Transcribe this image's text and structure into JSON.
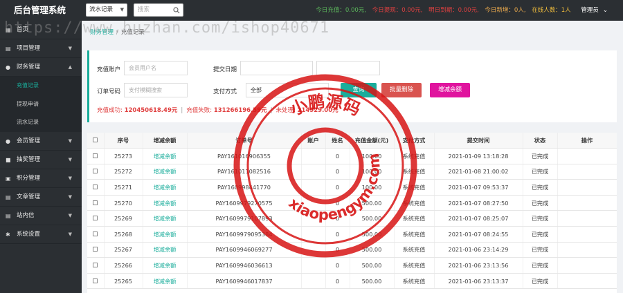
{
  "header": {
    "brand": "后台管理系统",
    "record_select": "流水记录",
    "search_placeholder": "搜索",
    "stats": [
      {
        "text": "今日充值：0.00元,",
        "color": "green"
      },
      {
        "text": "今日提现：0.00元,",
        "color": "red"
      },
      {
        "text": "明日到期：0.00元,",
        "color": "red"
      },
      {
        "text": "今日新增：0人,",
        "color": "orange"
      },
      {
        "text": "在线人数：1人",
        "color": "yellow"
      }
    ],
    "admin": "管理员"
  },
  "sidebar": {
    "items": [
      {
        "label": "首页",
        "icon": "grid-icon"
      },
      {
        "label": "项目管理",
        "icon": "list-icon"
      },
      {
        "label": "财务管理",
        "icon": "money-icon"
      },
      {
        "label": "会员管理",
        "icon": "user-icon"
      },
      {
        "label": "抽奖管理",
        "icon": "gift-icon"
      },
      {
        "label": "积分管理",
        "icon": "points-icon"
      },
      {
        "label": "文章管理",
        "icon": "doc-icon"
      },
      {
        "label": "站内信",
        "icon": "mail-icon"
      },
      {
        "label": "系统设置",
        "icon": "gear-icon"
      }
    ],
    "finance_sub": [
      "充值记录",
      "提现申请",
      "流水记录"
    ]
  },
  "breadcrumb": {
    "parent": "财务管理",
    "current": "充值记录"
  },
  "filter": {
    "account_label": "充值账户",
    "account_placeholder": "会员用户名",
    "date_label": "提交日期",
    "order_label": "订单号码",
    "order_placeholder": "支付模糊搜索",
    "pay_label": "支付方式",
    "pay_value": "全部",
    "search_button": "查询",
    "batch_delete_button": "批量删除",
    "adjust_button": "增减余额",
    "summary_success_label": "充值成功:",
    "summary_success_value": "120450618.49元",
    "summary_fail_label": "充值失败:",
    "summary_fail_value": "131266196.59元",
    "summary_pending_label": "未处理:",
    "summary_pending_value": "214929.00元"
  },
  "table": {
    "headers": [
      "序号",
      "增减余额",
      "订单号",
      "账户",
      "姓名",
      "充值金额(元)",
      "支付方式",
      "提交时间",
      "状态",
      "操作"
    ],
    "rows": [
      [
        "25273",
        "增减余额",
        "PAY161016906355",
        "",
        "0",
        "100.00",
        "系统充值",
        "2021-01-09 13:18:28",
        "已完成"
      ],
      [
        "25272",
        "增减余额",
        "PAY161011082516",
        "",
        "0",
        "100.00",
        "系统充值",
        "2021-01-08 21:00:02",
        "已完成"
      ],
      [
        "25271",
        "增减余额",
        "PAY160998441770",
        "",
        "0",
        "100.00",
        "系统充值",
        "2021-01-07 09:53:37",
        "已完成"
      ],
      [
        "25270",
        "增减余额",
        "PAY1609979270575",
        "",
        "0",
        "500.00",
        "系统充值",
        "2021-01-07 08:27:50",
        "已完成"
      ],
      [
        "25269",
        "增减余额",
        "PAY1609979107893",
        "",
        "0",
        "500.00",
        "系统充值",
        "2021-01-07 08:25:07",
        "已完成"
      ],
      [
        "25268",
        "增减余额",
        "PAY1609979095384",
        "",
        "0",
        "500.00",
        "系统充值",
        "2021-01-07 08:24:55",
        "已完成"
      ],
      [
        "25267",
        "增减余额",
        "PAY1609946069277",
        "",
        "0",
        "500.00",
        "系统充值",
        "2021-01-06 23:14:29",
        "已完成"
      ],
      [
        "25266",
        "增减余额",
        "PAY1609946036613",
        "",
        "0",
        "500.00",
        "系统充值",
        "2021-01-06 23:13:56",
        "已完成"
      ],
      [
        "25265",
        "增减余额",
        "PAY1609946017837",
        "",
        "0",
        "500.00",
        "系统充值",
        "2021-01-06 23:13:37",
        "已完成"
      ]
    ]
  },
  "watermark": {
    "url": "https://www.huzhan.com/ishop40671",
    "stamp_top": "小鹏源码",
    "stamp_bottom": "xiaopengym.com"
  }
}
